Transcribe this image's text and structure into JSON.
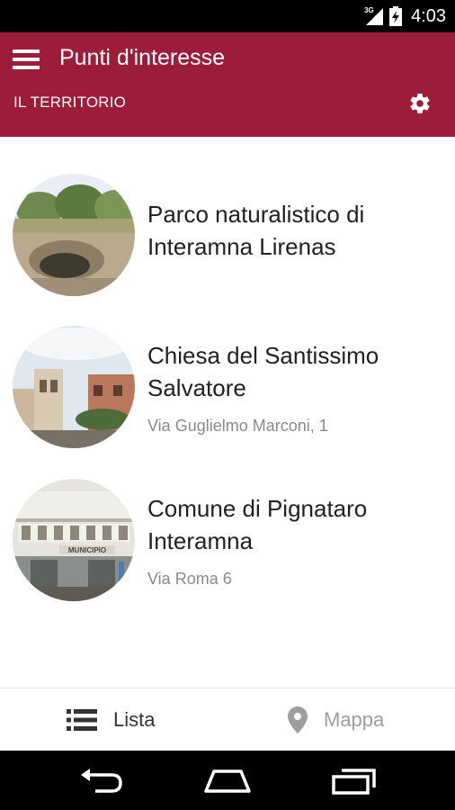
{
  "status_bar": {
    "network_label": "3G",
    "time": "4:03",
    "icons": [
      "signal-icon",
      "battery-charging-icon"
    ]
  },
  "app_bar": {
    "title": "Punti d'interesse",
    "section": "IL TERRITORIO",
    "menu_icon": "hamburger-menu-icon",
    "settings_icon": "gear-icon",
    "background_color": "#9d1c3a"
  },
  "poi_list": [
    {
      "name": "Parco naturalistico di Interamna Lirenas",
      "address": "",
      "thumbnail": "park-ruins-photo"
    },
    {
      "name": "Chiesa del Santissimo Salvatore",
      "address": "Via Guglielmo Marconi, 1",
      "thumbnail": "church-photo"
    },
    {
      "name": "Comune di Pignataro Interamna",
      "address": "Via Roma 6",
      "thumbnail": "town-hall-photo",
      "thumbnail_sign_text": "MUNICIPIO"
    }
  ],
  "bottom_tabs": [
    {
      "label": "Lista",
      "icon": "list-icon",
      "selected": true
    },
    {
      "label": "Mappa",
      "icon": "map-pin-icon",
      "selected": false
    }
  ],
  "nav_bar": {
    "buttons": [
      "back-icon",
      "home-icon",
      "recent-apps-icon"
    ]
  }
}
